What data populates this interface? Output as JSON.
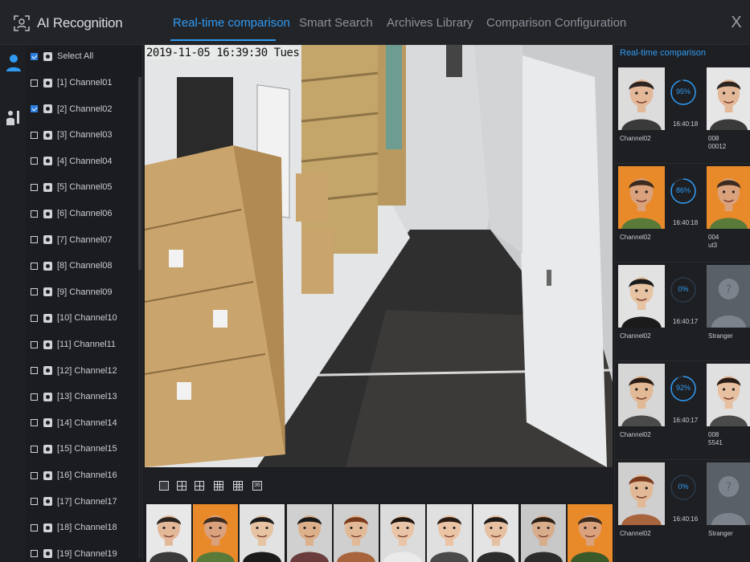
{
  "app": {
    "title": "AI Recognition",
    "close_label": "X",
    "tabs": [
      {
        "label": "Real-time comparison",
        "active": true
      },
      {
        "label": "Smart Search",
        "active": false
      },
      {
        "label": "Archives Library",
        "active": false
      },
      {
        "label": "Comparison Configuration",
        "active": false
      }
    ],
    "accent": "#2f9bf4"
  },
  "rail": {
    "icons": [
      "face-recognition-icon",
      "person-search-icon"
    ]
  },
  "channels": {
    "select_all": {
      "label": "Select All",
      "checked": true
    },
    "items": [
      {
        "label": "[1] Channel01",
        "checked": false
      },
      {
        "label": "[2] Channel02",
        "checked": true
      },
      {
        "label": "[3] Channel03",
        "checked": false
      },
      {
        "label": "[4] Channel04",
        "checked": false
      },
      {
        "label": "[5] Channel05",
        "checked": false
      },
      {
        "label": "[6] Channel06",
        "checked": false
      },
      {
        "label": "[7] Channel07",
        "checked": false
      },
      {
        "label": "[8] Channel08",
        "checked": false
      },
      {
        "label": "[9] Channel09",
        "checked": false
      },
      {
        "label": "[10] Channel10",
        "checked": false
      },
      {
        "label": "[11] Channel11",
        "checked": false
      },
      {
        "label": "[12] Channel12",
        "checked": false
      },
      {
        "label": "[13] Channel13",
        "checked": false
      },
      {
        "label": "[14] Channel14",
        "checked": false
      },
      {
        "label": "[15] Channel15",
        "checked": false
      },
      {
        "label": "[16] Channel16",
        "checked": false
      },
      {
        "label": "[17] Channel17",
        "checked": false
      },
      {
        "label": "[18] Channel18",
        "checked": false
      },
      {
        "label": "[19] Channel19",
        "checked": false
      }
    ]
  },
  "video": {
    "timestamp": "2019-11-05 16:39:30 Tues"
  },
  "layouts": {
    "icons": [
      "layout-1-icon",
      "layout-4-icon",
      "layout-6-icon",
      "layout-9-icon",
      "layout-16-icon"
    ],
    "last_label": "36"
  },
  "right_panel": {
    "title": "Real-time comparison",
    "cards": [
      {
        "similarity": "95%",
        "level": 0.95,
        "time": "16:40:18",
        "channel": "Channel02",
        "match": "008\n00012",
        "stranger": false
      },
      {
        "similarity": "86%",
        "level": 0.86,
        "time": "16:40:18",
        "channel": "Channel02",
        "match": "004\nut3",
        "stranger": false
      },
      {
        "similarity": "0%",
        "level": 0.0,
        "time": "16:40:17",
        "channel": "Channel02",
        "match": "Stranger",
        "stranger": true
      },
      {
        "similarity": "92%",
        "level": 0.92,
        "time": "16:40:17",
        "channel": "Channel02",
        "match": "008\n5541",
        "stranger": false
      },
      {
        "similarity": "0%",
        "level": 0.0,
        "time": "16:40:16",
        "channel": "Channel02",
        "match": "Stranger",
        "stranger": true
      }
    ]
  }
}
